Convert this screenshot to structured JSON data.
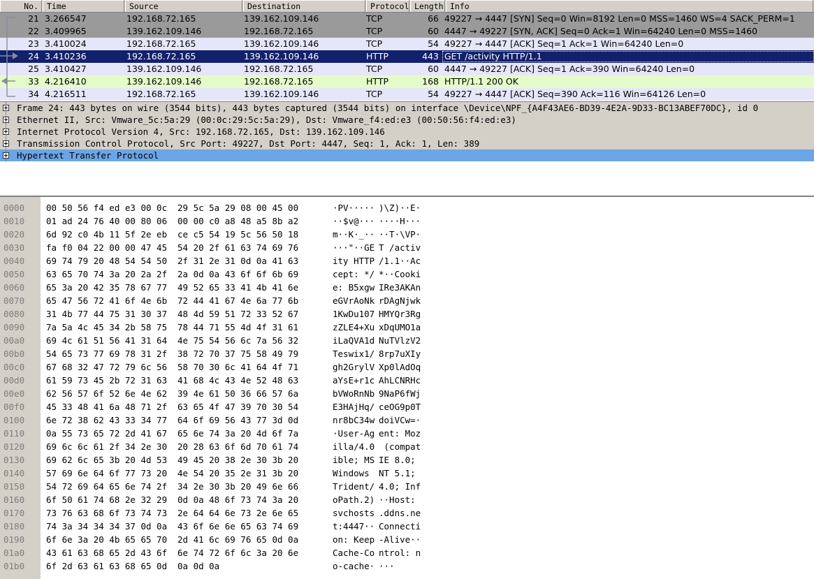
{
  "packet_list": {
    "columns": [
      "No.",
      "Time",
      "Source",
      "Destination",
      "Protocol",
      "Length",
      "Info"
    ],
    "rows": [
      {
        "no": "21",
        "time": "3.266547",
        "src": "192.168.72.165",
        "dst": "139.162.109.146",
        "proto": "TCP",
        "len": "66",
        "info": "49227 → 4447 [SYN] Seq=0 Win=8192 Len=0 MSS=1460 WS=4 SACK_PERM=1",
        "style": "gray"
      },
      {
        "no": "22",
        "time": "3.409965",
        "src": "139.162.109.146",
        "dst": "192.168.72.165",
        "proto": "TCP",
        "len": "60",
        "info": "4447 → 49227 [SYN, ACK] Seq=0 Ack=1 Win=64240 Len=0 MSS=1460",
        "style": "gray"
      },
      {
        "no": "23",
        "time": "3.410024",
        "src": "192.168.72.165",
        "dst": "139.162.109.146",
        "proto": "TCP",
        "len": "54",
        "info": "49227 → 4447 [ACK] Seq=1 Ack=1 Win=64240 Len=0",
        "style": "lav"
      },
      {
        "no": "24",
        "time": "3.410236",
        "src": "192.168.72.165",
        "dst": "139.162.109.146",
        "proto": "HTTP",
        "len": "443",
        "info": "GET /activity HTTP/1.1",
        "style": "sel"
      },
      {
        "no": "25",
        "time": "3.410427",
        "src": "139.162.109.146",
        "dst": "192.168.72.165",
        "proto": "TCP",
        "len": "60",
        "info": "4447 → 49227 [ACK] Seq=1 Ack=390 Win=64240 Len=0",
        "style": "lav"
      },
      {
        "no": "33",
        "time": "4.216410",
        "src": "139.162.109.146",
        "dst": "192.168.72.165",
        "proto": "HTTP",
        "len": "168",
        "info": "HTTP/1.1 200 OK",
        "style": "green"
      },
      {
        "no": "34",
        "time": "4.216511",
        "src": "192.168.72.165",
        "dst": "139.162.109.146",
        "proto": "TCP",
        "len": "54",
        "info": "49227 → 4447 [ACK] Seq=390 Ack=116 Win=64126 Len=0",
        "style": "lav"
      }
    ]
  },
  "detail_tree": {
    "rows": [
      {
        "label": "Frame 24: 443 bytes on wire (3544 bits), 443 bytes captured (3544 bits) on interface \\Device\\NPF_{A4F43AE6-BD39-4E2A-9D33-BC13ABEF70DC}, id 0",
        "selected": false
      },
      {
        "label": "Ethernet II, Src: Vmware_5c:5a:29 (00:0c:29:5c:5a:29), Dst: Vmware_f4:ed:e3 (00:50:56:f4:ed:e3)",
        "selected": false
      },
      {
        "label": "Internet Protocol Version 4, Src: 192.168.72.165, Dst: 139.162.109.146",
        "selected": false
      },
      {
        "label": "Transmission Control Protocol, Src Port: 49227, Dst Port: 4447, Seq: 1, Ack: 1, Len: 389",
        "selected": false
      },
      {
        "label": "Hypertext Transfer Protocol",
        "selected": true
      }
    ]
  },
  "bytes_pane": {
    "rows": [
      {
        "off": "0000",
        "hex1": "00 50 56 f4 ed e3 00 0c",
        "hex2": "29 5c 5a 29 08 00 45 00",
        "asc1": "·PV·····",
        "asc2": ")\\Z)··E·"
      },
      {
        "off": "0010",
        "hex1": "01 ad 24 76 40 00 80 06",
        "hex2": "00 00 c0 a8 48 a5 8b a2",
        "asc1": "··$v@···",
        "asc2": "····H···"
      },
      {
        "off": "0020",
        "hex1": "6d 92 c0 4b 11 5f 2e eb",
        "hex2": "ce c5 54 19 5c 56 50 18",
        "asc1": "m··K·_··",
        "asc2": "··T·\\VP·"
      },
      {
        "off": "0030",
        "hex1": "fa f0 04 22 00 00 47 45",
        "hex2": "54 20 2f 61 63 74 69 76",
        "asc1": "···\"··GE",
        "asc2": "T /activ"
      },
      {
        "off": "0040",
        "hex1": "69 74 79 20 48 54 54 50",
        "hex2": "2f 31 2e 31 0d 0a 41 63",
        "asc1": "ity HTTP",
        "asc2": "/1.1··Ac"
      },
      {
        "off": "0050",
        "hex1": "63 65 70 74 3a 20 2a 2f",
        "hex2": "2a 0d 0a 43 6f 6f 6b 69",
        "asc1": "cept: */",
        "asc2": "*··Cooki"
      },
      {
        "off": "0060",
        "hex1": "65 3a 20 42 35 78 67 77",
        "hex2": "49 52 65 33 41 4b 41 6e",
        "asc1": "e: B5xgw",
        "asc2": "IRe3AKAn"
      },
      {
        "off": "0070",
        "hex1": "65 47 56 72 41 6f 4e 6b",
        "hex2": "72 44 41 67 4e 6a 77 6b",
        "asc1": "eGVrAoNk",
        "asc2": "rDAgNjwk"
      },
      {
        "off": "0080",
        "hex1": "31 4b 77 44 75 31 30 37",
        "hex2": "48 4d 59 51 72 33 52 67",
        "asc1": "1KwDu107",
        "asc2": "HMYQr3Rg"
      },
      {
        "off": "0090",
        "hex1": "7a 5a 4c 45 34 2b 58 75",
        "hex2": "78 44 71 55 4d 4f 31 61",
        "asc1": "zZLE4+Xu",
        "asc2": "xDqUMO1a"
      },
      {
        "off": "00a0",
        "hex1": "69 4c 61 51 56 41 31 64",
        "hex2": "4e 75 54 56 6c 7a 56 32",
        "asc1": "iLaQVA1d",
        "asc2": "NuTVlzV2"
      },
      {
        "off": "00b0",
        "hex1": "54 65 73 77 69 78 31 2f",
        "hex2": "38 72 70 37 75 58 49 79",
        "asc1": "Teswix1/",
        "asc2": "8rp7uXIy"
      },
      {
        "off": "00c0",
        "hex1": "67 68 32 47 72 79 6c 56",
        "hex2": "58 70 30 6c 41 64 4f 71",
        "asc1": "gh2GrylV",
        "asc2": "Xp0lAdOq"
      },
      {
        "off": "00d0",
        "hex1": "61 59 73 45 2b 72 31 63",
        "hex2": "41 68 4c 43 4e 52 48 63",
        "asc1": "aYsE+r1c",
        "asc2": "AhLCNRHc"
      },
      {
        "off": "00e0",
        "hex1": "62 56 57 6f 52 6e 4e 62",
        "hex2": "39 4e 61 50 36 66 57 6a",
        "asc1": "bVWoRnNb",
        "asc2": "9NaP6fWj"
      },
      {
        "off": "00f0",
        "hex1": "45 33 48 41 6a 48 71 2f",
        "hex2": "63 65 4f 47 39 70 30 54",
        "asc1": "E3HAjHq/",
        "asc2": "ceOG9p0T"
      },
      {
        "off": "0100",
        "hex1": "6e 72 38 62 43 33 34 77",
        "hex2": "64 6f 69 56 43 77 3d 0d",
        "asc1": "nr8bC34w",
        "asc2": "doiVCw=·"
      },
      {
        "off": "0110",
        "hex1": "0a 55 73 65 72 2d 41 67",
        "hex2": "65 6e 74 3a 20 4d 6f 7a",
        "asc1": "·User-Ag",
        "asc2": "ent: Moz"
      },
      {
        "off": "0120",
        "hex1": "69 6c 6c 61 2f 34 2e 30",
        "hex2": "20 28 63 6f 6d 70 61 74",
        "asc1": "illa/4.0",
        "asc2": " (compat"
      },
      {
        "off": "0130",
        "hex1": "69 62 6c 65 3b 20 4d 53",
        "hex2": "49 45 20 38 2e 30 3b 20",
        "asc1": "ible; MS",
        "asc2": "IE 8.0; "
      },
      {
        "off": "0140",
        "hex1": "57 69 6e 64 6f 77 73 20",
        "hex2": "4e 54 20 35 2e 31 3b 20",
        "asc1": "Windows ",
        "asc2": "NT 5.1; "
      },
      {
        "off": "0150",
        "hex1": "54 72 69 64 65 6e 74 2f",
        "hex2": "34 2e 30 3b 20 49 6e 66",
        "asc1": "Trident/",
        "asc2": "4.0; Inf"
      },
      {
        "off": "0160",
        "hex1": "6f 50 61 74 68 2e 32 29",
        "hex2": "0d 0a 48 6f 73 74 3a 20",
        "asc1": "oPath.2)",
        "asc2": "··Host: "
      },
      {
        "off": "0170",
        "hex1": "73 76 63 68 6f 73 74 73",
        "hex2": "2e 64 64 6e 73 2e 6e 65",
        "asc1": "svchosts",
        "asc2": ".ddns.ne"
      },
      {
        "off": "0180",
        "hex1": "74 3a 34 34 34 37 0d 0a",
        "hex2": "43 6f 6e 6e 65 63 74 69",
        "asc1": "t:4447··",
        "asc2": "Connecti"
      },
      {
        "off": "0190",
        "hex1": "6f 6e 3a 20 4b 65 65 70",
        "hex2": "2d 41 6c 69 76 65 0d 0a",
        "asc1": "on: Keep",
        "asc2": "-Alive··"
      },
      {
        "off": "01a0",
        "hex1": "43 61 63 68 65 2d 43 6f",
        "hex2": "6e 74 72 6f 6c 3a 20 6e",
        "asc1": "Cache-Co",
        "asc2": "ntrol: n"
      },
      {
        "off": "01b0",
        "hex1": "6f 2d 63 61 63 68 65 0d",
        "hex2": "0a 0d 0a",
        "asc1": "o-cache·",
        "asc2": "···"
      }
    ]
  },
  "colors": {
    "selected_row": "#12216b",
    "gray_row": "#9a9a9a",
    "lavender_row": "#e6e6fa",
    "green_row": "#e3fcc9",
    "tree_bg": "#d4d0c8",
    "tree_selected": "#6ba5e7",
    "offset_col": "#d4d0c8"
  }
}
